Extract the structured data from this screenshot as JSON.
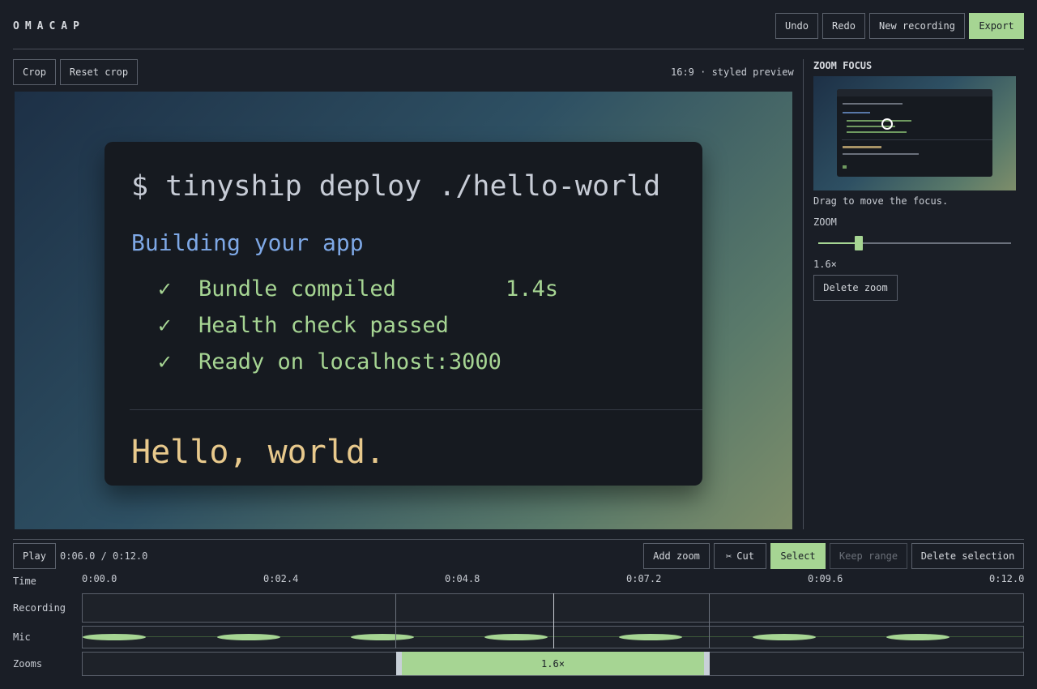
{
  "app": {
    "title": "OMACAP"
  },
  "header": {
    "undo_label": "Undo",
    "redo_label": "Redo",
    "new_recording_label": "New recording",
    "export_label": "Export"
  },
  "preview_toolbar": {
    "crop_label": "Crop",
    "reset_crop_label": "Reset crop",
    "aspect_info": "16:9 · styled preview"
  },
  "terminal": {
    "command": "$ tinyship deploy ./hello-world",
    "building": "Building your app",
    "steps": [
      {
        "check": "✓",
        "text": "Bundle compiled",
        "time": "1.4s"
      },
      {
        "check": "✓",
        "text": "Health check passed",
        "time": ""
      },
      {
        "check": "✓",
        "text": "Ready on localhost:3000",
        "time": ""
      }
    ],
    "output": "Hello, world."
  },
  "zoom_panel": {
    "title": "ZOOM FOCUS",
    "hint": "Drag to move the focus.",
    "zoom_label": "ZOOM",
    "zoom_value": "1.6×",
    "zoom_level_fraction": 0.21,
    "delete_label": "Delete zoom"
  },
  "timeline": {
    "play_label": "Play",
    "time_display": "0:06.0 / 0:12.0",
    "add_zoom_label": "Add zoom",
    "cut_icon": "scissors-icon",
    "cut_label": "Cut",
    "select_label": "Select",
    "keep_range_label": "Keep range",
    "delete_selection_label": "Delete selection",
    "time_label": "Time",
    "ticks": [
      "0:00.0",
      "0:02.4",
      "0:04.8",
      "0:07.2",
      "0:09.6",
      "0:12.0"
    ],
    "rows": {
      "recording": "Recording",
      "mic": "Mic",
      "zooms": "Zooms"
    },
    "zoom_segment_label": "1.6×",
    "playhead_time": 6.0,
    "duration": 12.0
  },
  "colors": {
    "accent": "#a6d593",
    "background": "#1a1e26",
    "border": "#5a606b"
  }
}
